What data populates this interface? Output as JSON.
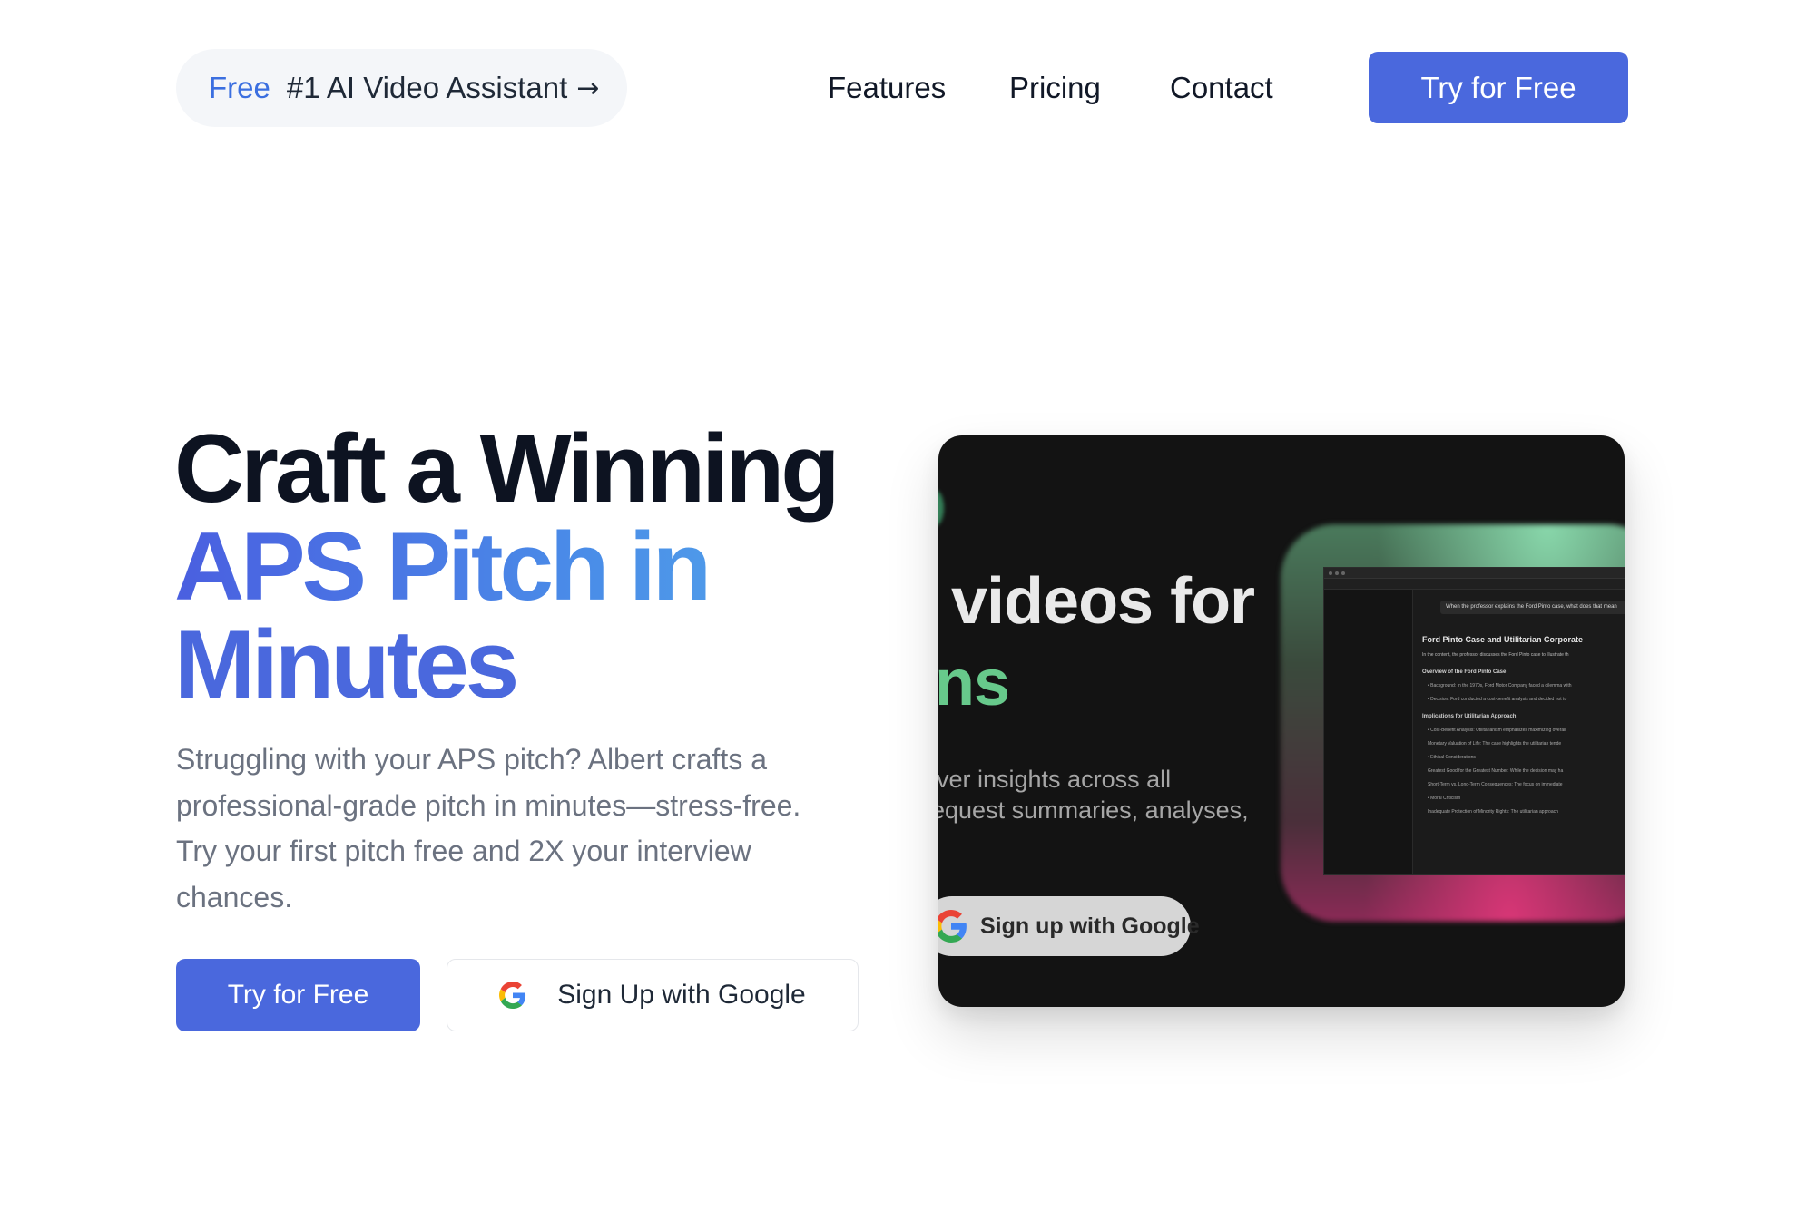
{
  "header": {
    "announcement": {
      "badge": "Free",
      "text": "#1 AI Video Assistant",
      "arrow": "→"
    },
    "nav": [
      {
        "label": "Features"
      },
      {
        "label": "Pricing"
      },
      {
        "label": "Contact"
      }
    ],
    "cta_label": "Try for Free"
  },
  "hero": {
    "title_line1": "Craft a Winning",
    "title_line2": "APS Pitch in",
    "title_line3": "Minutes",
    "subtitle": "Struggling with your APS pitch? Albert crafts a professional-grade pitch in minutes—stress-free. Try your first pitch free and 2X your interview chances.",
    "cta_label": "Try for Free",
    "google_label": "Sign Up with Google"
  },
  "video_preview": {
    "headline": "videos for",
    "headline_accent": "ns",
    "body_line1": "iver insights across all",
    "body_line2": "equest summaries, analyses,",
    "pill_label": "Sign up with Google",
    "app": {
      "question": "When the professor explains the Ford Pinto case, what does that mean",
      "heading": "Ford Pinto Case and Utilitarian Corporate",
      "intro": "In the content, the professor discusses the Ford Pinto case to illustrate th",
      "section1": "Overview of the Ford Pinto Case",
      "item1": "• Background: In the 1970s, Ford Motor Company faced a dilemma with",
      "item2": "• Decision: Ford conducted a cost-benefit analysis and decided not to",
      "section2": "Implications for Utilitarian Approach",
      "item3": "• Cost-Benefit Analysis: Utilitarianism emphasizes maximizing overall",
      "item4": "Monetary Valuation of Life: The case highlights the utilitarian tende",
      "item5": "• Ethical Considerations",
      "item6": "Greatest Good for the Greatest Number: While the decision may ha",
      "item7": "Short-Term vs. Long-Term Consequences: The focus on immediate",
      "item8": "• Moral Criticism",
      "item9": "Inadequate Protection of Minority Rights: The utilitarian approach"
    }
  },
  "colors": {
    "primary": "#4a68dd",
    "accent_blue": "#3b6fe0",
    "heading_dark": "#0d1321",
    "subtitle_gray": "#6b7280",
    "video_bg": "#131313",
    "video_green": "#67c98b"
  }
}
